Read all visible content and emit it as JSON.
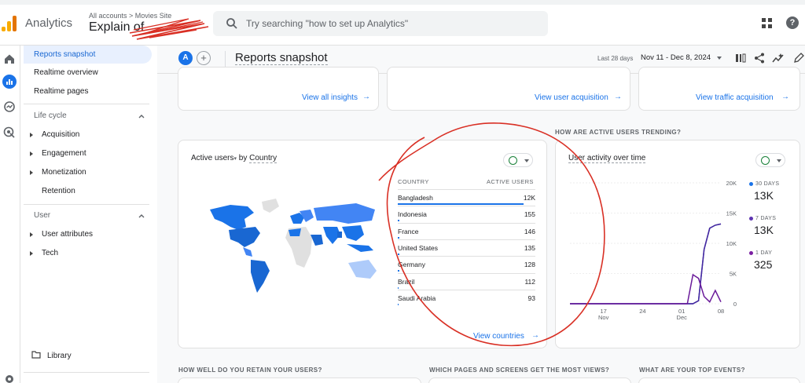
{
  "app": {
    "name": "Analytics"
  },
  "account": {
    "crumb": "All accounts > Movies Site",
    "title": "Explain of"
  },
  "search": {
    "placeholder": "Try searching \"how to set up Analytics\""
  },
  "sidebar": {
    "top_items": [
      "Reports snapshot",
      "Realtime overview",
      "Realtime pages"
    ],
    "lifecycle": {
      "label": "Life cycle",
      "items": [
        "Acquisition",
        "Engagement",
        "Monetization",
        "Retention"
      ]
    },
    "user": {
      "label": "User",
      "items": [
        "User attributes",
        "Tech"
      ]
    },
    "library": "Library"
  },
  "header": {
    "avatar": "A",
    "title": "Reports snapshot",
    "date_label": "Last 28 days",
    "date_range": "Nov 11 - Dec 8, 2024"
  },
  "top_cards": {
    "insights_link": "View all insights",
    "user_acq_link": "View user acquisition",
    "traffic_acq_link": "View traffic acquisition"
  },
  "country_card": {
    "title_metric": "Active users",
    "title_by": "by",
    "title_dim": "Country",
    "col_country": "COUNTRY",
    "col_users": "ACTIVE USERS",
    "rows": [
      {
        "country": "Bangladesh",
        "users": "12K",
        "share": 1.0
      },
      {
        "country": "Indonesia",
        "users": "155",
        "share": 0.0129
      },
      {
        "country": "France",
        "users": "146",
        "share": 0.0122
      },
      {
        "country": "United States",
        "users": "135",
        "share": 0.0113
      },
      {
        "country": "Germany",
        "users": "128",
        "share": 0.0107
      },
      {
        "country": "Brazil",
        "users": "112",
        "share": 0.0093
      },
      {
        "country": "Saudi Arabia",
        "users": "93",
        "share": 0.0078
      }
    ],
    "link": "View countries"
  },
  "trend": {
    "section_label": "HOW ARE ACTIVE USERS TRENDING?",
    "title": "User activity over time",
    "legend": [
      {
        "label": "30 DAYS",
        "value": "13K",
        "color": "#1a73e8"
      },
      {
        "label": "7 DAYS",
        "value": "13K",
        "color": "#5e35b1"
      },
      {
        "label": "1 DAY",
        "value": "325",
        "color": "#7b1fa2"
      }
    ]
  },
  "chart_data": {
    "type": "line",
    "title": "User activity over time",
    "x_ticks": [
      "17\nNov",
      "24",
      "01\nDec",
      "08"
    ],
    "y_ticks": [
      "0",
      "5K",
      "10K",
      "15K",
      "20K"
    ],
    "ylim": [
      0,
      20000
    ],
    "x_days": [
      "Nov 11",
      "Dec 8"
    ],
    "series": [
      {
        "name": "30 DAYS",
        "color": "#3f51b5",
        "x": [
          0,
          5,
          10,
          15,
          20,
          22,
          23,
          24,
          25,
          26,
          27
        ],
        "y": [
          0,
          0,
          0,
          0,
          0,
          0,
          500,
          9000,
          12500,
          13000,
          13200
        ]
      },
      {
        "name": "7 DAYS",
        "color": "#4527a0",
        "x": [
          0,
          5,
          10,
          15,
          20,
          22,
          23,
          24,
          25,
          26,
          27
        ],
        "y": [
          0,
          0,
          0,
          0,
          0,
          0,
          500,
          9000,
          12500,
          13000,
          13200
        ]
      },
      {
        "name": "1 DAY",
        "color": "#6a1b9a",
        "x": [
          0,
          5,
          10,
          15,
          20,
          21,
          22,
          23,
          24,
          25,
          26,
          27
        ],
        "y": [
          0,
          0,
          0,
          0,
          0,
          0,
          4800,
          4200,
          1200,
          300,
          2200,
          300
        ]
      }
    ]
  },
  "bottom_sections": [
    "HOW WELL DO YOU RETAIN YOUR USERS?",
    "WHICH PAGES AND SCREENS GET THE MOST VIEWS?",
    "WHAT ARE YOUR TOP EVENTS?"
  ]
}
